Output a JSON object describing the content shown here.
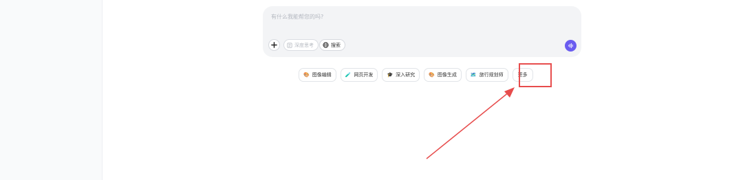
{
  "composer": {
    "placeholder": "有什么我能帮您的吗?",
    "deep_think_label": "深度思考",
    "search_label": "搜索"
  },
  "quick_actions": [
    {
      "icon": "🎨",
      "label": "图像编辑"
    },
    {
      "icon": "🧪",
      "label": "网页开发"
    },
    {
      "icon": "🎓",
      "label": "深入研究"
    },
    {
      "icon": "🎨",
      "label": "图像生成"
    },
    {
      "icon": "🗺️",
      "label": "旅行规划师"
    }
  ],
  "more_label": "更多",
  "colors": {
    "accent": "#6a5cf0",
    "annotation": "#e74c4c"
  }
}
